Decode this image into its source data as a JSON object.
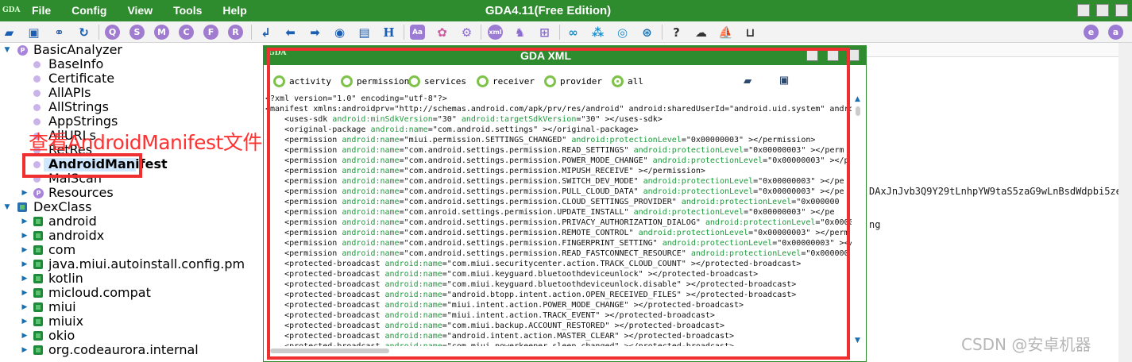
{
  "app": {
    "logo": "GDA",
    "title": "GDA4.11(Free Edition)",
    "menu": [
      "File",
      "Config",
      "View",
      "Tools",
      "Help"
    ]
  },
  "toolbar": {
    "circle_buttons": [
      "Q",
      "S",
      "M",
      "C",
      "F",
      "R"
    ],
    "aa_label": "Aa",
    "xml_label": "xml",
    "h_label": "H",
    "help_label": "?"
  },
  "tree": {
    "items": [
      {
        "label": "BasicAnalyzer",
        "level": 0,
        "kind": "root-p",
        "twist": "▼"
      },
      {
        "label": "BaseInfo",
        "level": 1,
        "kind": "dot"
      },
      {
        "label": "Certificate",
        "level": 1,
        "kind": "dot"
      },
      {
        "label": "AllAPIs",
        "level": 1,
        "kind": "dot"
      },
      {
        "label": "AllStrings",
        "level": 1,
        "kind": "dot"
      },
      {
        "label": "AppStrings",
        "level": 1,
        "kind": "dot"
      },
      {
        "label": "AllURLs",
        "level": 1,
        "kind": "dot"
      },
      {
        "label": "RetRes",
        "level": 1,
        "kind": "dot"
      },
      {
        "label": "AndroidManifest",
        "level": 1,
        "kind": "dot"
      },
      {
        "label": "MalScan",
        "level": 1,
        "kind": "dot"
      },
      {
        "label": "Resources",
        "level": 1,
        "kind": "p",
        "twist": "▶"
      },
      {
        "label": "DexClass",
        "level": 0,
        "kind": "root-dex",
        "twist": "▼"
      },
      {
        "label": "android",
        "level": 1,
        "kind": "pkg",
        "twist": "▶"
      },
      {
        "label": "androidx",
        "level": 1,
        "kind": "pkg",
        "twist": "▶"
      },
      {
        "label": "com",
        "level": 1,
        "kind": "pkg",
        "twist": "▶"
      },
      {
        "label": "java.miui.autoinstall.config.pm",
        "level": 1,
        "kind": "pkg",
        "twist": "▶"
      },
      {
        "label": "kotlin",
        "level": 1,
        "kind": "pkg",
        "twist": "▶"
      },
      {
        "label": "micloud.compat",
        "level": 1,
        "kind": "pkg",
        "twist": "▶"
      },
      {
        "label": "miui",
        "level": 1,
        "kind": "pkg",
        "twist": "▶"
      },
      {
        "label": "miuix",
        "level": 1,
        "kind": "pkg",
        "twist": "▶"
      },
      {
        "label": "okio",
        "level": 1,
        "kind": "pkg",
        "twist": "▶"
      },
      {
        "label": "org.codeaurora.internal",
        "level": 1,
        "kind": "pkg",
        "twist": "▶"
      }
    ],
    "annotation": "查看AndroidManifest文件"
  },
  "right_panel": {
    "line1": "DAxJnJvb3Q9Y29tLnhpYW9taS5zaG9wLnBsdWdpbi5zeXN",
    "line2": "ng"
  },
  "watermark": "CSDN @安卓机器",
  "dialog": {
    "logo": "GDA",
    "title": "GDA XML",
    "filters": [
      {
        "label": "activity",
        "checked": false
      },
      {
        "label": "permission",
        "checked": false
      },
      {
        "label": "services",
        "checked": false
      },
      {
        "label": "receiver",
        "checked": false
      },
      {
        "label": "provider",
        "checked": false
      },
      {
        "label": "all",
        "checked": true
      }
    ],
    "xml_lines": [
      [
        [
          "t",
          "<?xml version=\"1.0\" encoding=\"utf-8\"?>"
        ]
      ],
      [
        [
          "t",
          "<manifest xmlns:androidprv=\"http://schemas.android.com/apk/prv/res/android\" android:sharedUserId=\"android.uid.system\" android"
        ]
      ],
      [
        [
          "t",
          "    <uses-sdk "
        ],
        [
          "a",
          "android:minSdkVersion"
        ],
        [
          "t",
          "=\"30\" "
        ],
        [
          "a",
          "android:targetSdkVersion"
        ],
        [
          "t",
          "=\"30\" ></uses-sdk>"
        ]
      ],
      [
        [
          "t",
          "    <original-package "
        ],
        [
          "a",
          "android:name"
        ],
        [
          "t",
          "=\"com.android.settings\" ></original-package>"
        ]
      ],
      [
        [
          "t",
          "    <permission "
        ],
        [
          "a",
          "android:name"
        ],
        [
          "t",
          "=\"miui.permission.SETTINGS_CHANGED\" "
        ],
        [
          "a",
          "android:protectionLevel"
        ],
        [
          "t",
          "=\"0x00000003\" ></permission>"
        ]
      ],
      [
        [
          "t",
          "    <permission "
        ],
        [
          "a",
          "android:name"
        ],
        [
          "t",
          "=\"com.android.settings.permission.READ_SETTINGS\" "
        ],
        [
          "a",
          "android:protectionLevel"
        ],
        [
          "t",
          "=\"0x00000003\" ></perm"
        ]
      ],
      [
        [
          "t",
          "    <permission "
        ],
        [
          "a",
          "android:name"
        ],
        [
          "t",
          "=\"com.android.settings.permission.POWER_MODE_CHANGE\" "
        ],
        [
          "a",
          "android:protectionLevel"
        ],
        [
          "t",
          "=\"0x00000003\" ></p"
        ]
      ],
      [
        [
          "t",
          "    <permission "
        ],
        [
          "a",
          "android:name"
        ],
        [
          "t",
          "=\"com.android.settings.permission.MIPUSH_RECEIVE\" ></permission>"
        ]
      ],
      [
        [
          "t",
          "    <permission "
        ],
        [
          "a",
          "android:name"
        ],
        [
          "t",
          "=\"com.android.settings.permission.SWITCH_DEV_MODE\" "
        ],
        [
          "a",
          "android:protectionLevel"
        ],
        [
          "t",
          "=\"0x00000003\" ></pe"
        ]
      ],
      [
        [
          "t",
          "    <permission "
        ],
        [
          "a",
          "android:name"
        ],
        [
          "t",
          "=\"com.android.settings.permission.PULL_CLOUD_DATA\" "
        ],
        [
          "a",
          "android:protectionLevel"
        ],
        [
          "t",
          "=\"0x00000003\" ></pe"
        ]
      ],
      [
        [
          "t",
          "    <permission "
        ],
        [
          "a",
          "android:name"
        ],
        [
          "t",
          "=\"com.android.settings.permission.CLOUD_SETTINGS_PROVIDER\" "
        ],
        [
          "a",
          "android:protectionLevel"
        ],
        [
          "t",
          "=\"0x000000"
        ]
      ],
      [
        [
          "t",
          "    <permission "
        ],
        [
          "a",
          "android:name"
        ],
        [
          "t",
          "=\"com.anroid.settings.permission.UPDATE_INSTALL\" "
        ],
        [
          "a",
          "android:protectionLevel"
        ],
        [
          "t",
          "=\"0x00000003\" ></pe"
        ]
      ],
      [
        [
          "t",
          "    <permission "
        ],
        [
          "a",
          "android:name"
        ],
        [
          "t",
          "=\"com.android.settings.permission.PRIVACY_AUTHORIZATION_DIALOG\" "
        ],
        [
          "a",
          "android:protectionLevel"
        ],
        [
          "t",
          "=\"0x0000"
        ]
      ],
      [
        [
          "t",
          "    <permission "
        ],
        [
          "a",
          "android:name"
        ],
        [
          "t",
          "=\"com.android.settings.permission.REMOTE_CONTROL\" "
        ],
        [
          "a",
          "android:protectionLevel"
        ],
        [
          "t",
          "=\"0x00000003\" ></perm"
        ]
      ],
      [
        [
          "t",
          "    <permission "
        ],
        [
          "a",
          "android:name"
        ],
        [
          "t",
          "=\"com.android.settings.permission.FINGERPRINT_SETTING\" "
        ],
        [
          "a",
          "android:protectionLevel"
        ],
        [
          "t",
          "=\"0x00000003\" ></"
        ]
      ],
      [
        [
          "t",
          "    <permission "
        ],
        [
          "a",
          "android:name"
        ],
        [
          "t",
          "=\"com.android.settings.permission.READ_FASTCONNECT_RESOURCE\" "
        ],
        [
          "a",
          "android:protectionLevel"
        ],
        [
          "t",
          "=\"0x000000"
        ]
      ],
      [
        [
          "t",
          "    <protected-broadcast "
        ],
        [
          "a",
          "android:name"
        ],
        [
          "t",
          "=\"com.miui.securitycenter.action.TRACK_CLOUD_COUNT\" ></protected-broadcast>"
        ]
      ],
      [
        [
          "t",
          "    <protected-broadcast "
        ],
        [
          "a",
          "android:name"
        ],
        [
          "t",
          "=\"com.miui.keyguard.bluetoothdeviceunlock\" ></protected-broadcast>"
        ]
      ],
      [
        [
          "t",
          "    <protected-broadcast "
        ],
        [
          "a",
          "android:name"
        ],
        [
          "t",
          "=\"com.miui.keyguard.bluetoothdeviceunlock.disable\" ></protected-broadcast>"
        ]
      ],
      [
        [
          "t",
          "    <protected-broadcast "
        ],
        [
          "a",
          "android:name"
        ],
        [
          "t",
          "=\"android.btopp.intent.action.OPEN_RECEIVED_FILES\" ></protected-broadcast>"
        ]
      ],
      [
        [
          "t",
          "    <protected-broadcast "
        ],
        [
          "a",
          "android:name"
        ],
        [
          "t",
          "=\"miui.intent.action.POWER_MODE_CHANGE\" ></protected-broadcast>"
        ]
      ],
      [
        [
          "t",
          "    <protected-broadcast "
        ],
        [
          "a",
          "android:name"
        ],
        [
          "t",
          "=\"miui.intent.action.TRACK_EVENT\" ></protected-broadcast>"
        ]
      ],
      [
        [
          "t",
          "    <protected-broadcast "
        ],
        [
          "a",
          "android:name"
        ],
        [
          "t",
          "=\"com.miui.backup.ACCOUNT_RESTORED\" ></protected-broadcast>"
        ]
      ],
      [
        [
          "t",
          "    <protected-broadcast "
        ],
        [
          "a",
          "android:name"
        ],
        [
          "t",
          "=\"android.intent.action.MASTER_CLEAR\" ></protected-broadcast>"
        ]
      ],
      [
        [
          "t",
          "    <protected-broadcast "
        ],
        [
          "a",
          "android:name"
        ],
        [
          "t",
          "=\"com.miui.powerkeeper.sleep_changed\" ></protected-broadcast>"
        ]
      ]
    ]
  }
}
